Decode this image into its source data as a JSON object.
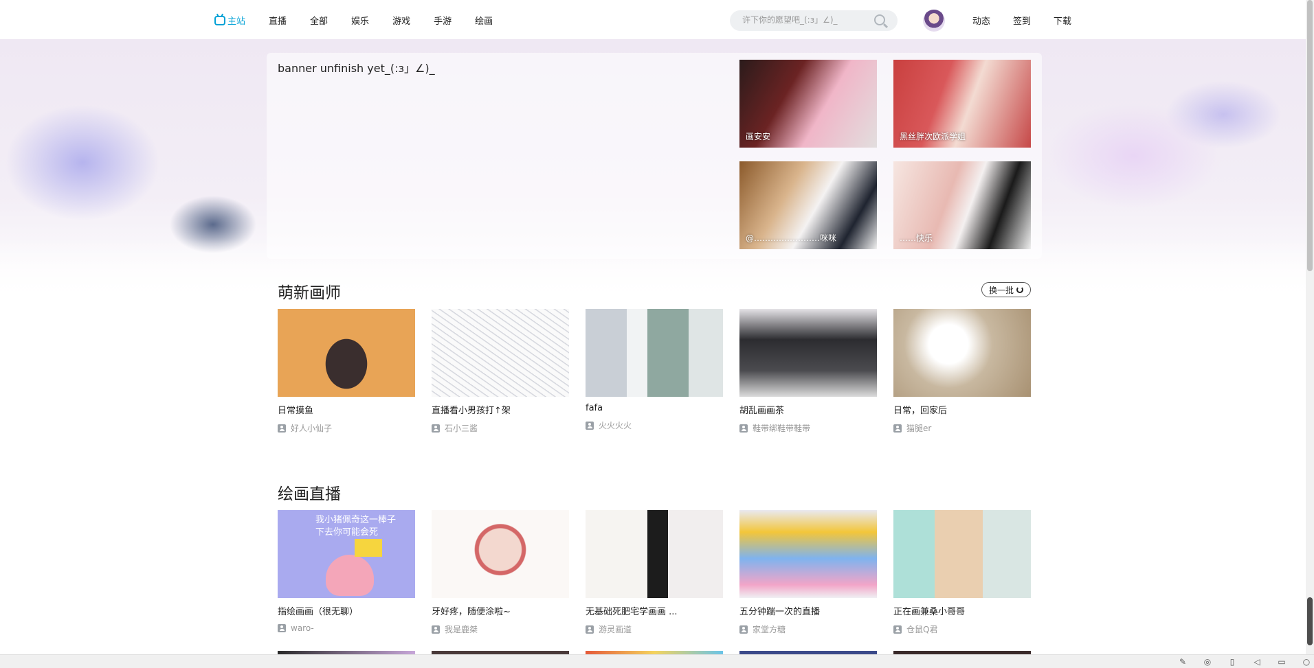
{
  "nav": {
    "home": "主站",
    "items": [
      "直播",
      "全部",
      "娱乐",
      "游戏",
      "手游",
      "绘画"
    ]
  },
  "search": {
    "placeholder": "许下你的愿望吧_(:з」∠)_"
  },
  "right_links": [
    "动态",
    "签到",
    "下载"
  ],
  "banner": {
    "text": "banner unfinish yet_(:з」∠)_",
    "featured": [
      {
        "caption": "画安安"
      },
      {
        "caption": "黑丝胖次欧派学姐"
      },
      {
        "caption": "@……………………咪咪"
      },
      {
        "caption": "……快乐"
      }
    ]
  },
  "section_new": {
    "title": "萌新画师",
    "refresh_label": "换一批",
    "cards": [
      {
        "title": "日常摸鱼",
        "author": "好人小仙子"
      },
      {
        "title": "直播看小男孩打↑架",
        "author": "石小三酱"
      },
      {
        "title": "fafa",
        "author": "火火火火"
      },
      {
        "title": "胡乱画画茶",
        "author": "鞋带绑鞋带鞋带"
      },
      {
        "title": "日常，回家后",
        "author": "猫腿er"
      }
    ]
  },
  "section_live": {
    "title": "绘画直播",
    "cards": [
      {
        "title": "指绘画画（很无聊）",
        "author": "waro-"
      },
      {
        "title": "牙好疼，随便涂啦~",
        "author": "我是鹿桀"
      },
      {
        "title": "无基础死肥宅学画画 ...",
        "author": "游灵画道"
      },
      {
        "title": "五分钟踹一次的直播",
        "author": "家堂方糖"
      },
      {
        "title": "正在画兼桑小哥哥",
        "author": "仓鼠Q君"
      }
    ]
  },
  "thumb_text": {
    "peppa": "我小猪佩奇这一棒子\n下去你可能会死"
  }
}
